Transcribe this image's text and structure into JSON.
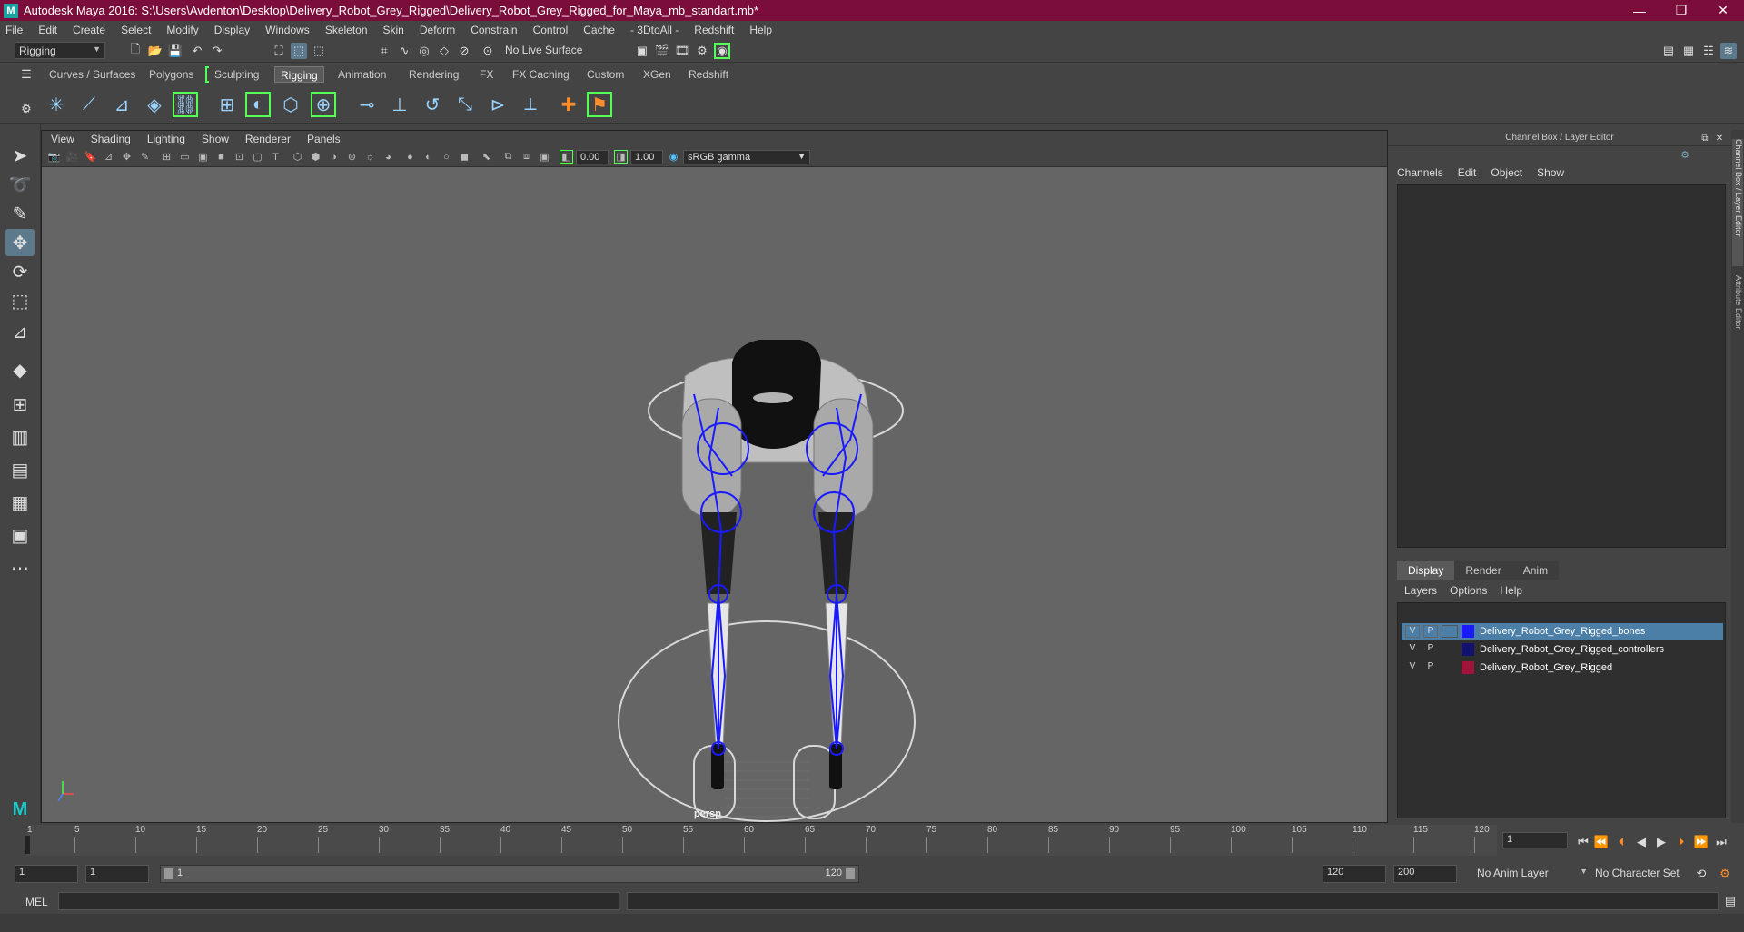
{
  "titlebar": {
    "title": "Autodesk Maya 2016: S:\\Users\\Avdenton\\Desktop\\Delivery_Robot_Grey_Rigged\\Delivery_Robot_Grey_Rigged_for_Maya_mb_standart.mb*",
    "minimize": "—",
    "maximize": "❐",
    "close": "✕"
  },
  "menubar": [
    "File",
    "Edit",
    "Create",
    "Select",
    "Modify",
    "Display",
    "Windows",
    "Skeleton",
    "Skin",
    "Deform",
    "Constrain",
    "Control",
    "Cache",
    "- 3DtoAll -",
    "Redshift",
    "Help"
  ],
  "statusline": {
    "mode": "Rigging",
    "live_surface": "No Live Surface"
  },
  "shelf_tabs": [
    "Curves / Surfaces",
    "Polygons",
    "Sculpting",
    "Rigging",
    "Animation",
    "Rendering",
    "FX",
    "FX Caching",
    "Custom",
    "XGen",
    "Redshift"
  ],
  "shelf_active": "Rigging",
  "viewport": {
    "menu": [
      "View",
      "Shading",
      "Lighting",
      "Show",
      "Renderer",
      "Panels"
    ],
    "exposure": "0.00",
    "gamma": "1.00",
    "color_space": "sRGB gamma",
    "camera": "persp"
  },
  "channel_box": {
    "title": "Channel Box / Layer Editor",
    "menu": [
      "Channels",
      "Edit",
      "Object",
      "Show"
    ]
  },
  "layer_editor": {
    "tabs": [
      "Display",
      "Render",
      "Anim"
    ],
    "active_tab": "Display",
    "menu": [
      "Layers",
      "Options",
      "Help"
    ],
    "layers": [
      {
        "v": "V",
        "p": "P",
        "color": "#1a1aff",
        "name": "Delivery_Robot_Grey_Rigged_bones",
        "selected": true
      },
      {
        "v": "V",
        "p": "P",
        "color": "#12126e",
        "name": "Delivery_Robot_Grey_Rigged_controllers",
        "selected": false
      },
      {
        "v": "V",
        "p": "P",
        "color": "#a3143a",
        "name": "Delivery_Robot_Grey_Rigged",
        "selected": false
      }
    ]
  },
  "side_tabs": {
    "channel_box": "Channel Box / Layer Editor",
    "attribute_editor": "Attribute Editor"
  },
  "timeline": {
    "ticks": [
      "1",
      "5",
      "10",
      "15",
      "20",
      "25",
      "30",
      "35",
      "40",
      "45",
      "50",
      "55",
      "60",
      "65",
      "70",
      "75",
      "80",
      "85",
      "90",
      "95",
      "100",
      "105",
      "110",
      "115",
      "120"
    ],
    "current_frame": "1"
  },
  "range": {
    "start": "1",
    "playback_start": "1",
    "range_start_label": "1",
    "range_end_label": "120",
    "playback_end": "120",
    "end": "200",
    "anim_layer": "No Anim Layer",
    "character_set": "No Character Set"
  },
  "cmdline": {
    "label": "MEL"
  }
}
